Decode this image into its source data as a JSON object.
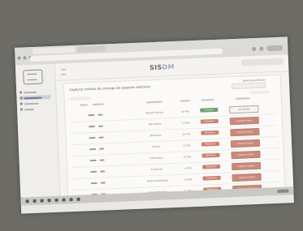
{
  "app": {
    "brand_prefix": "SIS",
    "brand_suffix": "DM"
  },
  "panel": {
    "title": "Capturar boletas de entrega de paquete electoral",
    "filter_label": "Seleccione Distrito"
  },
  "rows": [
    {
      "name": "Nueva Carlota",
      "location": "La Paz",
      "status": "Completo",
      "status_color": "#6f9e73",
      "action": "Ver detalle",
      "action_style": "outline"
    },
    {
      "name": "Bacubirito",
      "location": "La Paz",
      "status": "Pendiente",
      "status_color": "#c9826f",
      "action": "Capturar boleta",
      "action_style": "filled"
    },
    {
      "name": "Benifacio",
      "location": "La Paz",
      "status": "Pendiente",
      "status_color": "#c9826f",
      "action": "Capturar boleta",
      "action_style": "filled"
    },
    {
      "name": "Cardel",
      "location": "La Paz",
      "status": "Pendiente",
      "status_color": "#c9826f",
      "action": "Capturar boleta",
      "action_style": "filled"
    },
    {
      "name": "Chihuahua",
      "location": "La Paz",
      "status": "Pendiente",
      "status_color": "#c9826f",
      "action": "Capturar boleta",
      "action_style": "filled"
    },
    {
      "name": "Fundición",
      "location": "La Paz",
      "status": "Pendiente",
      "status_color": "#c9826f",
      "action": "Capturar boleta",
      "action_style": "filled"
    },
    {
      "name": "Santa Guadalupe",
      "location": "La Paz",
      "status": "Pendiente",
      "status_color": "#c9826f",
      "action": "Capturar boleta",
      "action_style": "filled"
    },
    {
      "name": "San Bartolomé",
      "location": "La Paz",
      "status": "Pendiente",
      "status_color": "#c9826f",
      "action": "Capturar boleta",
      "action_style": "filled"
    }
  ]
}
